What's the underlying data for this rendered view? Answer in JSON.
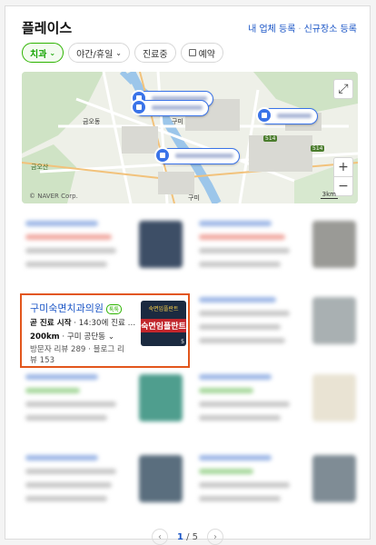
{
  "header": {
    "title": "플레이스",
    "link_register": "내 업체 등록",
    "separator": "·",
    "link_new_place": "신규장소 등록"
  },
  "filters": [
    {
      "label": "치과",
      "active": true,
      "icon": "chevron-down-icon"
    },
    {
      "label": "야간/휴일",
      "active": false,
      "icon": "chevron-down-icon"
    },
    {
      "label": "진료중",
      "active": false,
      "icon": ""
    },
    {
      "label": "예약",
      "active": false,
      "icon": "calendar-icon"
    }
  ],
  "map": {
    "labels": {
      "gumi": "구미",
      "gumi2": "구미",
      "geumodong": "금오동",
      "geumo_mountain": "금오산",
      "road_514a": "514",
      "road_514b": "514"
    },
    "credit": "© NAVER Corp.",
    "scale": "3km",
    "zoom_in": "+",
    "zoom_out": "−",
    "expand_icon": "expand-icon"
  },
  "highlighted_place": {
    "name": "구미숙면치과의원",
    "badge": "톡톡",
    "status": "곧 진료 시작",
    "hours": "14:30에 진료 …",
    "distance": "200km",
    "location": "구미 공단동",
    "reviews_line1": "방문자 리뷰 289 · 블로그 리",
    "reviews_line2": "뷰 153",
    "image_text_top": "숙면임플란트",
    "image_text_main": "숙면임플란트",
    "image_page": "5"
  },
  "pagination": {
    "current": "1",
    "separator": " / ",
    "total": "5",
    "prev_icon": "chevron-left-icon",
    "next_icon": "chevron-right-icon"
  },
  "colors": {
    "accent_green": "#2db400",
    "link_blue": "#1a55c6",
    "highlight_border": "#e2561c",
    "map_pin_blue": "#3a73e8"
  }
}
